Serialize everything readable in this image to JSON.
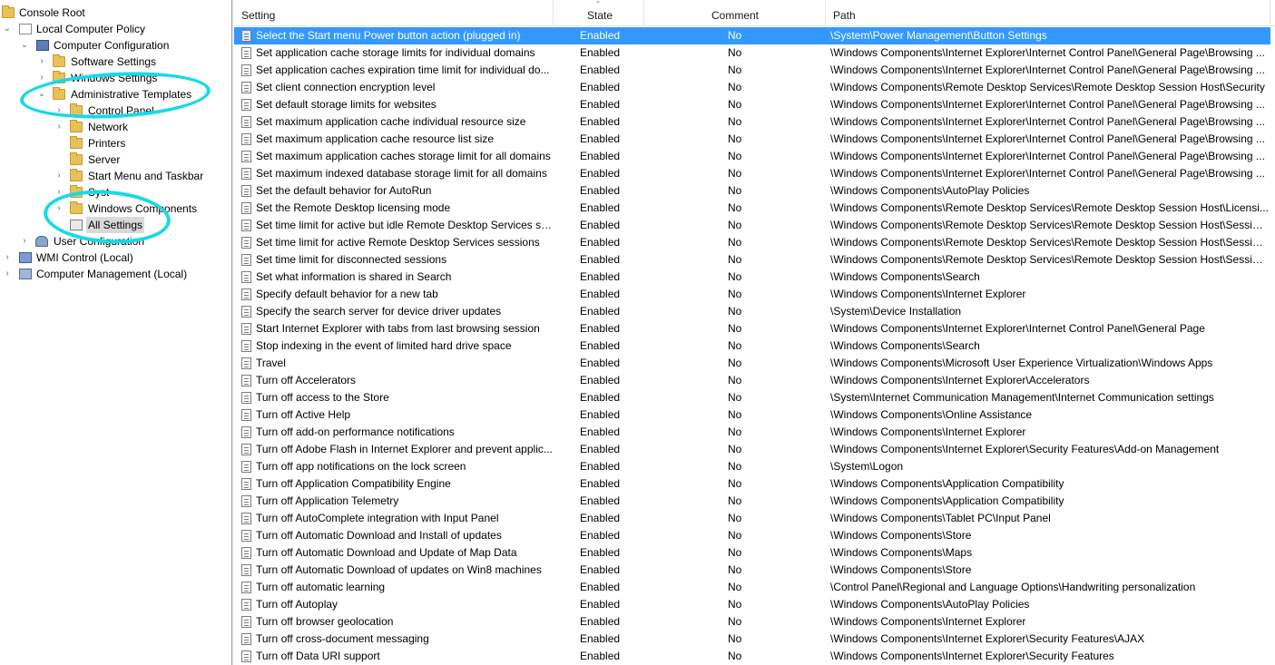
{
  "tree": {
    "items": [
      {
        "label": "Console Root",
        "icon": "folder-icon"
      },
      {
        "label": "Local Computer Policy",
        "icon": "policy-icon"
      },
      {
        "label": "Computer Configuration",
        "icon": "computer-icon"
      },
      {
        "label": "Software Settings",
        "icon": "folder-icon"
      },
      {
        "label": "Windows Settings",
        "icon": "folder-icon"
      },
      {
        "label": "Administrative Templates",
        "icon": "folder-icon"
      },
      {
        "label": "Control Panel",
        "icon": "folder-icon"
      },
      {
        "label": "Network",
        "icon": "folder-icon"
      },
      {
        "label": "Printers",
        "icon": "folder-icon"
      },
      {
        "label": "Server",
        "icon": "folder-icon"
      },
      {
        "label": "Start Menu and Taskbar",
        "icon": "folder-icon"
      },
      {
        "label": "Syst",
        "icon": "folder-icon"
      },
      {
        "label": "Windows Components",
        "icon": "folder-icon"
      },
      {
        "label": "All Settings",
        "icon": "all-settings-icon"
      },
      {
        "label": "User Configuration",
        "icon": "user-icon"
      },
      {
        "label": "WMI Control (Local)",
        "icon": "wmi-icon"
      },
      {
        "label": "Computer Management (Local)",
        "icon": "computer-management-icon"
      }
    ]
  },
  "columns": {
    "setting": "Setting",
    "state": "State",
    "comment": "Comment",
    "path": "Path"
  },
  "colors": {
    "selection": "#3399ff",
    "annotation": "#19d9e6"
  },
  "rows": [
    {
      "setting": "Select the Start menu Power button action (plugged in)",
      "state": "Enabled",
      "comment": "No",
      "path": "\\System\\Power Management\\Button Settings"
    },
    {
      "setting": "Set application cache storage limits for individual domains",
      "state": "Enabled",
      "comment": "No",
      "path": "\\Windows Components\\Internet Explorer\\Internet Control Panel\\General Page\\Browsing ..."
    },
    {
      "setting": "Set application caches expiration time limit for individual do...",
      "state": "Enabled",
      "comment": "No",
      "path": "\\Windows Components\\Internet Explorer\\Internet Control Panel\\General Page\\Browsing ..."
    },
    {
      "setting": "Set client connection encryption level",
      "state": "Enabled",
      "comment": "No",
      "path": "\\Windows Components\\Remote Desktop Services\\Remote Desktop Session Host\\Security"
    },
    {
      "setting": "Set default storage limits for websites",
      "state": "Enabled",
      "comment": "No",
      "path": "\\Windows Components\\Internet Explorer\\Internet Control Panel\\General Page\\Browsing ..."
    },
    {
      "setting": "Set maximum application cache individual resource size",
      "state": "Enabled",
      "comment": "No",
      "path": "\\Windows Components\\Internet Explorer\\Internet Control Panel\\General Page\\Browsing ..."
    },
    {
      "setting": "Set maximum application cache resource list size",
      "state": "Enabled",
      "comment": "No",
      "path": "\\Windows Components\\Internet Explorer\\Internet Control Panel\\General Page\\Browsing ..."
    },
    {
      "setting": "Set maximum application caches storage limit for all domains",
      "state": "Enabled",
      "comment": "No",
      "path": "\\Windows Components\\Internet Explorer\\Internet Control Panel\\General Page\\Browsing ..."
    },
    {
      "setting": "Set maximum indexed database storage limit for all domains",
      "state": "Enabled",
      "comment": "No",
      "path": "\\Windows Components\\Internet Explorer\\Internet Control Panel\\General Page\\Browsing ..."
    },
    {
      "setting": "Set the default behavior for AutoRun",
      "state": "Enabled",
      "comment": "No",
      "path": "\\Windows Components\\AutoPlay Policies"
    },
    {
      "setting": "Set the Remote Desktop licensing mode",
      "state": "Enabled",
      "comment": "No",
      "path": "\\Windows Components\\Remote Desktop Services\\Remote Desktop Session Host\\Licensi..."
    },
    {
      "setting": "Set time limit for active but idle Remote Desktop Services se...",
      "state": "Enabled",
      "comment": "No",
      "path": "\\Windows Components\\Remote Desktop Services\\Remote Desktop Session Host\\Session..."
    },
    {
      "setting": "Set time limit for active Remote Desktop Services sessions",
      "state": "Enabled",
      "comment": "No",
      "path": "\\Windows Components\\Remote Desktop Services\\Remote Desktop Session Host\\Session..."
    },
    {
      "setting": "Set time limit for disconnected sessions",
      "state": "Enabled",
      "comment": "No",
      "path": "\\Windows Components\\Remote Desktop Services\\Remote Desktop Session Host\\Session..."
    },
    {
      "setting": "Set what information is shared in Search",
      "state": "Enabled",
      "comment": "No",
      "path": "\\Windows Components\\Search"
    },
    {
      "setting": "Specify default behavior for a new tab",
      "state": "Enabled",
      "comment": "No",
      "path": "\\Windows Components\\Internet Explorer"
    },
    {
      "setting": "Specify the search server for device driver updates",
      "state": "Enabled",
      "comment": "No",
      "path": "\\System\\Device Installation"
    },
    {
      "setting": "Start Internet Explorer with tabs from last browsing session",
      "state": "Enabled",
      "comment": "No",
      "path": "\\Windows Components\\Internet Explorer\\Internet Control Panel\\General Page"
    },
    {
      "setting": "Stop indexing in the event of limited hard drive space",
      "state": "Enabled",
      "comment": "No",
      "path": "\\Windows Components\\Search"
    },
    {
      "setting": "Travel",
      "state": "Enabled",
      "comment": "No",
      "path": "\\Windows Components\\Microsoft User Experience Virtualization\\Windows Apps"
    },
    {
      "setting": "Turn off Accelerators",
      "state": "Enabled",
      "comment": "No",
      "path": "\\Windows Components\\Internet Explorer\\Accelerators"
    },
    {
      "setting": "Turn off access to the Store",
      "state": "Enabled",
      "comment": "No",
      "path": "\\System\\Internet Communication Management\\Internet Communication settings"
    },
    {
      "setting": "Turn off Active Help",
      "state": "Enabled",
      "comment": "No",
      "path": "\\Windows Components\\Online Assistance"
    },
    {
      "setting": "Turn off add-on performance notifications",
      "state": "Enabled",
      "comment": "No",
      "path": "\\Windows Components\\Internet Explorer"
    },
    {
      "setting": "Turn off Adobe Flash in Internet Explorer and prevent applic...",
      "state": "Enabled",
      "comment": "No",
      "path": "\\Windows Components\\Internet Explorer\\Security Features\\Add-on Management"
    },
    {
      "setting": "Turn off app notifications on the lock screen",
      "state": "Enabled",
      "comment": "No",
      "path": "\\System\\Logon"
    },
    {
      "setting": "Turn off Application Compatibility Engine",
      "state": "Enabled",
      "comment": "No",
      "path": "\\Windows Components\\Application Compatibility"
    },
    {
      "setting": "Turn off Application Telemetry",
      "state": "Enabled",
      "comment": "No",
      "path": "\\Windows Components\\Application Compatibility"
    },
    {
      "setting": "Turn off AutoComplete integration with Input Panel",
      "state": "Enabled",
      "comment": "No",
      "path": "\\Windows Components\\Tablet PC\\Input Panel"
    },
    {
      "setting": "Turn off Automatic Download and Install of updates",
      "state": "Enabled",
      "comment": "No",
      "path": "\\Windows Components\\Store"
    },
    {
      "setting": "Turn off Automatic Download and Update of Map Data",
      "state": "Enabled",
      "comment": "No",
      "path": "\\Windows Components\\Maps"
    },
    {
      "setting": "Turn off Automatic Download of updates on Win8 machines",
      "state": "Enabled",
      "comment": "No",
      "path": "\\Windows Components\\Store"
    },
    {
      "setting": "Turn off automatic learning",
      "state": "Enabled",
      "comment": "No",
      "path": "\\Control Panel\\Regional and Language Options\\Handwriting personalization"
    },
    {
      "setting": "Turn off Autoplay",
      "state": "Enabled",
      "comment": "No",
      "path": "\\Windows Components\\AutoPlay Policies"
    },
    {
      "setting": "Turn off browser geolocation",
      "state": "Enabled",
      "comment": "No",
      "path": "\\Windows Components\\Internet Explorer"
    },
    {
      "setting": "Turn off cross-document messaging",
      "state": "Enabled",
      "comment": "No",
      "path": "\\Windows Components\\Internet Explorer\\Security Features\\AJAX"
    },
    {
      "setting": "Turn off Data URI support",
      "state": "Enabled",
      "comment": "No",
      "path": "\\Windows Components\\Internet Explorer\\Security Features"
    }
  ]
}
